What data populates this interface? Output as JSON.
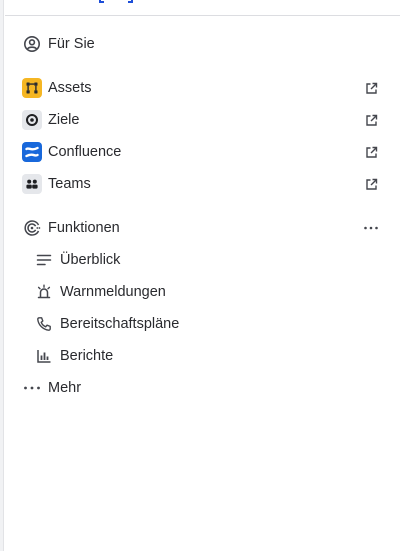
{
  "nav": {
    "fuer_sie": {
      "label": "Für Sie",
      "icon": "user-circle-icon"
    },
    "apps": [
      {
        "label": "Assets",
        "icon": "assets-icon",
        "color": "#f5b623",
        "external_icon": "external-link-icon"
      },
      {
        "label": "Ziele",
        "icon": "goals-icon",
        "color": "#e5e7eb",
        "external_icon": "external-link-icon"
      },
      {
        "label": "Confluence",
        "icon": "confluence-icon",
        "color": "#1868db",
        "external_icon": "external-link-icon"
      },
      {
        "label": "Teams",
        "icon": "teams-icon",
        "color": "#e5e7eb",
        "external_icon": "external-link-icon"
      }
    ],
    "funktionen": {
      "label": "Funktionen",
      "icon": "operations-icon",
      "more_icon": "more-horizontal-icon"
    },
    "sub_items": [
      {
        "label": "Überblick",
        "icon": "list-icon"
      },
      {
        "label": "Warnmeldungen",
        "icon": "alarm-light-icon"
      },
      {
        "label": "Bereitschaftspläne",
        "icon": "phone-icon"
      },
      {
        "label": "Berichte",
        "icon": "bar-chart-icon"
      }
    ],
    "mehr": {
      "label": "Mehr",
      "icon": "more-horizontal-icon"
    }
  }
}
